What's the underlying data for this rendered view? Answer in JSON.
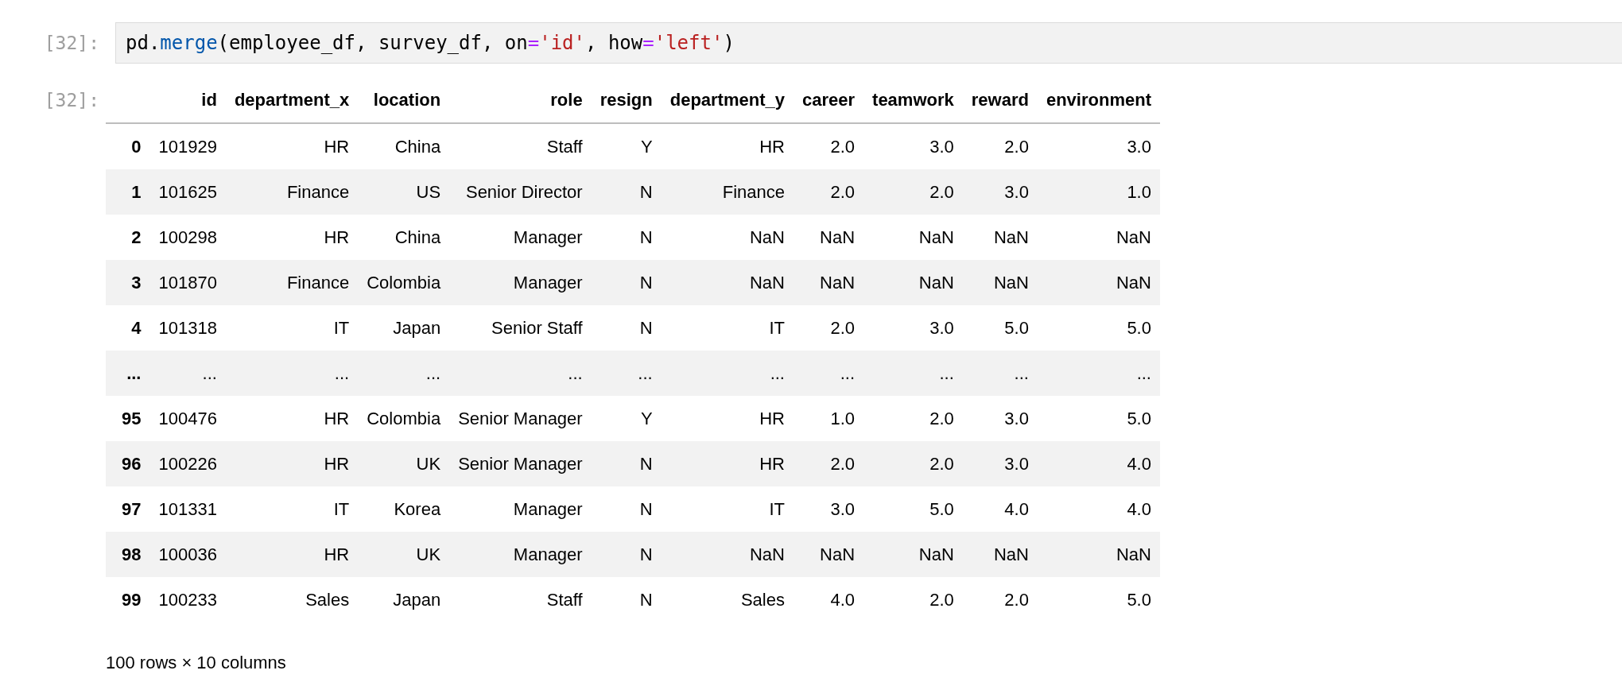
{
  "input_cell": {
    "prompt": "[32]:",
    "code": [
      {
        "text": "pd",
        "kind": "plain"
      },
      {
        "text": ".",
        "kind": "plain"
      },
      {
        "text": "merge",
        "kind": "function"
      },
      {
        "text": "(employee_df, survey_df, on",
        "kind": "plain"
      },
      {
        "text": "=",
        "kind": "operator"
      },
      {
        "text": "'id'",
        "kind": "string"
      },
      {
        "text": ", how",
        "kind": "plain"
      },
      {
        "text": "=",
        "kind": "operator"
      },
      {
        "text": "'left'",
        "kind": "string"
      },
      {
        "text": ")",
        "kind": "plain"
      }
    ]
  },
  "output_cell": {
    "prompt": "[32]:",
    "table": {
      "columns": [
        "",
        "id",
        "department_x",
        "location",
        "role",
        "resign",
        "department_y",
        "career",
        "teamwork",
        "reward",
        "environment"
      ],
      "rows": [
        [
          "0",
          "101929",
          "HR",
          "China",
          "Staff",
          "Y",
          "HR",
          "2.0",
          "3.0",
          "2.0",
          "3.0"
        ],
        [
          "1",
          "101625",
          "Finance",
          "US",
          "Senior Director",
          "N",
          "Finance",
          "2.0",
          "2.0",
          "3.0",
          "1.0"
        ],
        [
          "2",
          "100298",
          "HR",
          "China",
          "Manager",
          "N",
          "NaN",
          "NaN",
          "NaN",
          "NaN",
          "NaN"
        ],
        [
          "3",
          "101870",
          "Finance",
          "Colombia",
          "Manager",
          "N",
          "NaN",
          "NaN",
          "NaN",
          "NaN",
          "NaN"
        ],
        [
          "4",
          "101318",
          "IT",
          "Japan",
          "Senior Staff",
          "N",
          "IT",
          "2.0",
          "3.0",
          "5.0",
          "5.0"
        ],
        [
          "...",
          "...",
          "...",
          "...",
          "...",
          "...",
          "...",
          "...",
          "...",
          "...",
          "..."
        ],
        [
          "95",
          "100476",
          "HR",
          "Colombia",
          "Senior Manager",
          "Y",
          "HR",
          "1.0",
          "2.0",
          "3.0",
          "5.0"
        ],
        [
          "96",
          "100226",
          "HR",
          "UK",
          "Senior Manager",
          "N",
          "HR",
          "2.0",
          "2.0",
          "3.0",
          "4.0"
        ],
        [
          "97",
          "101331",
          "IT",
          "Korea",
          "Manager",
          "N",
          "IT",
          "3.0",
          "5.0",
          "4.0",
          "4.0"
        ],
        [
          "98",
          "100036",
          "HR",
          "UK",
          "Manager",
          "N",
          "NaN",
          "NaN",
          "NaN",
          "NaN",
          "NaN"
        ],
        [
          "99",
          "100233",
          "Sales",
          "Japan",
          "Staff",
          "N",
          "Sales",
          "4.0",
          "2.0",
          "2.0",
          "5.0"
        ]
      ]
    },
    "shape_note": "100 rows × 10 columns"
  }
}
